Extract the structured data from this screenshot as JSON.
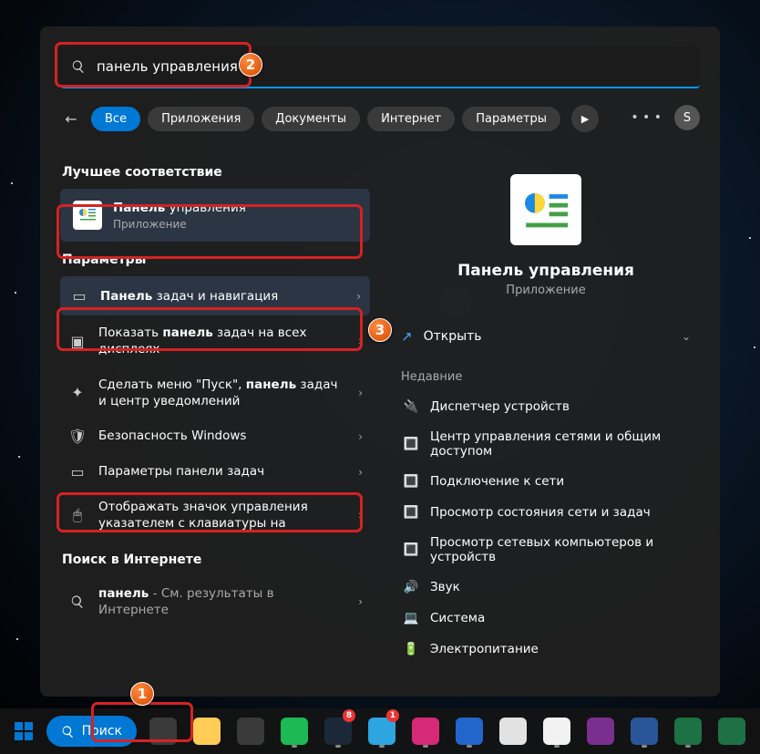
{
  "search": {
    "value": "панель управления",
    "typed": "панель",
    "placeholder": ""
  },
  "tabs": {
    "all": "Все",
    "apps": "Приложения",
    "docs": "Документы",
    "web": "Интернет",
    "settings": "Параметры"
  },
  "more_label": "…",
  "avatar_initial": "S",
  "sections": {
    "best_match": "Лучшее соответствие",
    "settings": "Параметры",
    "web": "Поиск в Интернете"
  },
  "best_match": {
    "title_bold": "Панель",
    "title_rest": " управления",
    "subtitle": "Приложение"
  },
  "settings_results": [
    {
      "bold": "Панель",
      "rest": " задач и навигация",
      "icon": "taskbar-icon"
    },
    {
      "pre": "Показать ",
      "bold": "панель",
      "rest": " задач на всех дисплеях",
      "icon": "displays-icon"
    },
    {
      "pre": "Сделать меню \"Пуск\", ",
      "bold": "панель",
      "rest": " задач и центр уведомлений",
      "icon": "sparkle-icon"
    },
    {
      "pre": "Безопасность Windows",
      "bold": "",
      "rest": "",
      "icon": "shield-icon"
    },
    {
      "pre": "Параметры панели задач",
      "bold": "",
      "rest": "",
      "icon": "taskbar-icon"
    },
    {
      "pre": "Отображать значок управления указателем с клавиатуры на",
      "bold": "",
      "rest": "",
      "icon": "mouse-icon"
    }
  ],
  "web_result": {
    "bold": "панель",
    "rest": " - См. результаты в Интернете"
  },
  "preview": {
    "title": "Панель управления",
    "subtitle": "Приложение",
    "open": "Открыть",
    "recent_header": "Недавние",
    "recent": [
      "Диспетчер устройств",
      "Центр управления сетями и общим доступом",
      "Подключение к сети",
      "Просмотр состояния сети и задач",
      "Просмотр сетевых компьютеров и устройств",
      "Звук",
      "Система",
      "Электропитание"
    ]
  },
  "taskbar": {
    "search_label": "Поиск",
    "items": [
      {
        "name": "start",
        "color": "#0078d4"
      },
      {
        "name": "search",
        "label": "Поиск"
      },
      {
        "name": "task-view",
        "color": "#3a3a3a"
      },
      {
        "name": "explorer",
        "color": "#ffcc55"
      },
      {
        "name": "calculator",
        "color": "#3a3a3a"
      },
      {
        "name": "spotify",
        "color": "#1db954",
        "dot": true
      },
      {
        "name": "steam",
        "color": "#1b2838",
        "badge": "8",
        "dot": true
      },
      {
        "name": "telegram",
        "color": "#2ca5e0",
        "badge": "1",
        "dot": true
      },
      {
        "name": "instagram",
        "color": "#d62976",
        "dot": true
      },
      {
        "name": "blue-app",
        "color": "#2266cc",
        "dot": true
      },
      {
        "name": "mail",
        "color": "#e2e2e2"
      },
      {
        "name": "chrome",
        "color": "#f2f2f2",
        "dot": true
      },
      {
        "name": "onenote",
        "color": "#7a2f8f"
      },
      {
        "name": "word",
        "color": "#2a5699",
        "dot": true
      },
      {
        "name": "excel",
        "color": "#1e7145",
        "dot": true
      },
      {
        "name": "excel2",
        "color": "#1e7145"
      }
    ]
  },
  "annotation_numbers": {
    "a1": "1",
    "a2": "2",
    "a3": "3"
  }
}
